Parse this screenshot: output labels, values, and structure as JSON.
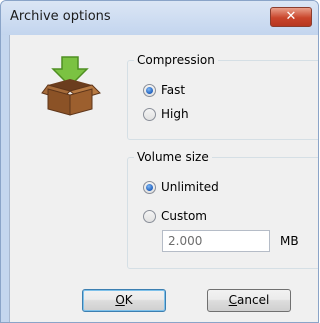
{
  "window": {
    "title": "Archive options",
    "close_glyph": "✕"
  },
  "compression": {
    "legend": "Compression",
    "options": [
      {
        "label": "Fast",
        "selected": true
      },
      {
        "label": "High",
        "selected": false
      }
    ]
  },
  "volume": {
    "legend": "Volume size",
    "options": [
      {
        "label": "Unlimited",
        "selected": true
      },
      {
        "label": "Custom",
        "selected": false
      }
    ],
    "size_value": "2.000",
    "unit": "MB"
  },
  "buttons": {
    "ok_mnemonic": "O",
    "ok_rest": "K",
    "cancel_mnemonic": "C",
    "cancel_rest": "ancel"
  },
  "icons": {
    "app": "archive-box-icon"
  },
  "colors": {
    "accent": "#1f5fbd",
    "close": "#c9452b"
  }
}
